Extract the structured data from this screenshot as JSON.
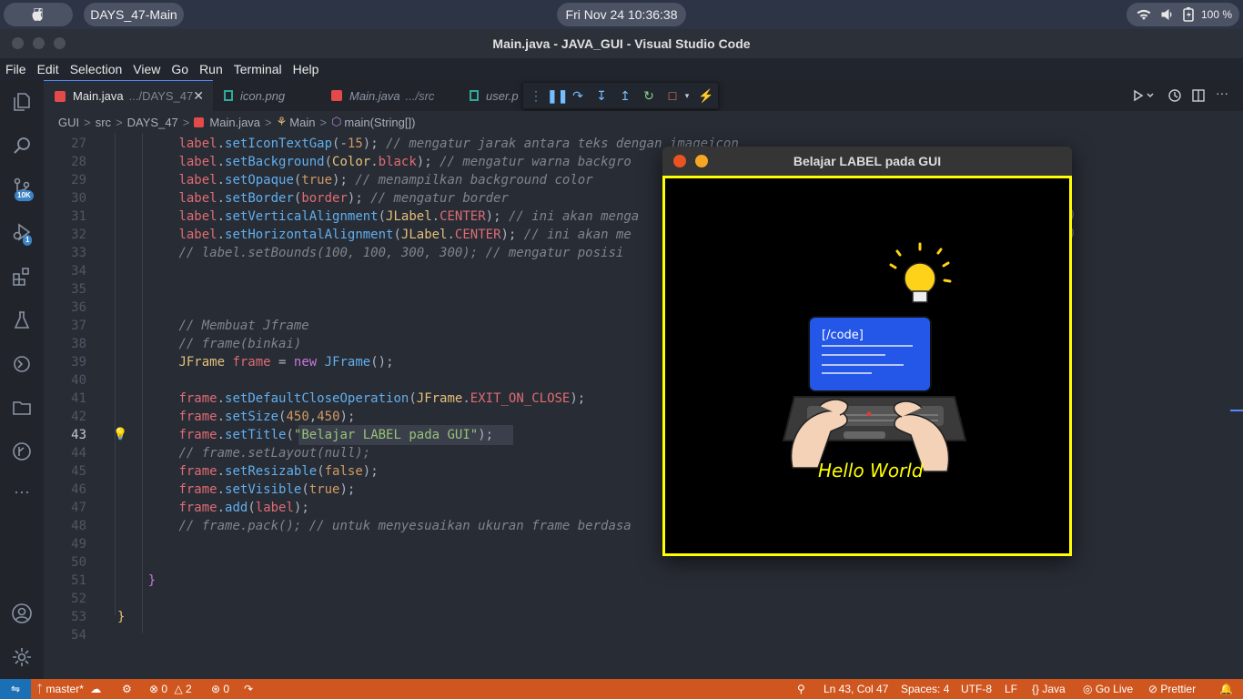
{
  "topbar": {
    "workspace": "DAYS_47-Main",
    "datetime": "Fri Nov 24  10:36:38",
    "battery": "100 %"
  },
  "window": {
    "title": "Main.java - JAVA_GUI - Visual Studio Code"
  },
  "menu": [
    "File",
    "Edit",
    "Selection",
    "View",
    "Go",
    "Run",
    "Terminal",
    "Help"
  ],
  "activity": {
    "scm_badge": "10K",
    "debug_badge": "1"
  },
  "tabs": [
    {
      "label": "Main.java",
      "path": ".../DAYS_47"
    },
    {
      "label": "icon.png",
      "path": ""
    },
    {
      "label": "Main.java",
      "path": ".../src"
    },
    {
      "label": "user.p",
      "path": ""
    }
  ],
  "breadcrumb": [
    "GUI",
    "src",
    "DAYS_47",
    "Main.java",
    "Main",
    "main(String[])"
  ],
  "editor": {
    "current_line": 43
  },
  "code_lines": [
    {
      "n": "27",
      "tokens": [
        {
          "t": "        ",
          "c": "p"
        },
        {
          "t": "label",
          "c": "v"
        },
        {
          "t": ".",
          "c": "p"
        },
        {
          "t": "setIconTextGap",
          "c": "f"
        },
        {
          "t": "(-",
          "c": "p"
        },
        {
          "t": "15",
          "c": "n"
        },
        {
          "t": "); ",
          "c": "p"
        },
        {
          "t": "// mengatur jarak antara teks dengan imageicon",
          "c": "c"
        }
      ]
    },
    {
      "n": "28",
      "tokens": [
        {
          "t": "        ",
          "c": "p"
        },
        {
          "t": "label",
          "c": "v"
        },
        {
          "t": ".",
          "c": "p"
        },
        {
          "t": "setBackground",
          "c": "f"
        },
        {
          "t": "(",
          "c": "p"
        },
        {
          "t": "Color",
          "c": "t"
        },
        {
          "t": ".",
          "c": "p"
        },
        {
          "t": "black",
          "c": "v"
        },
        {
          "t": "); ",
          "c": "p"
        },
        {
          "t": "// mengatur warna backgro",
          "c": "c"
        }
      ]
    },
    {
      "n": "29",
      "tokens": [
        {
          "t": "        ",
          "c": "p"
        },
        {
          "t": "label",
          "c": "v"
        },
        {
          "t": ".",
          "c": "p"
        },
        {
          "t": "setOpaque",
          "c": "f"
        },
        {
          "t": "(",
          "c": "p"
        },
        {
          "t": "true",
          "c": "n"
        },
        {
          "t": "); ",
          "c": "p"
        },
        {
          "t": "// menampilkan background color",
          "c": "c"
        }
      ]
    },
    {
      "n": "30",
      "tokens": [
        {
          "t": "        ",
          "c": "p"
        },
        {
          "t": "label",
          "c": "v"
        },
        {
          "t": ".",
          "c": "p"
        },
        {
          "t": "setBorder",
          "c": "f"
        },
        {
          "t": "(",
          "c": "p"
        },
        {
          "t": "border",
          "c": "v"
        },
        {
          "t": "); ",
          "c": "p"
        },
        {
          "t": "// mengatur border",
          "c": "c"
        }
      ]
    },
    {
      "n": "31",
      "tokens": [
        {
          "t": "        ",
          "c": "p"
        },
        {
          "t": "label",
          "c": "v"
        },
        {
          "t": ".",
          "c": "p"
        },
        {
          "t": "setVerticalAlignment",
          "c": "f"
        },
        {
          "t": "(",
          "c": "p"
        },
        {
          "t": "JLabel",
          "c": "t"
        },
        {
          "t": ".",
          "c": "p"
        },
        {
          "t": "CENTER",
          "c": "v"
        },
        {
          "t": "); ",
          "c": "p"
        },
        {
          "t": "// ini akan menga                                        ical(TOP, BOTTOM)",
          "c": "c"
        }
      ]
    },
    {
      "n": "32",
      "tokens": [
        {
          "t": "        ",
          "c": "p"
        },
        {
          "t": "label",
          "c": "v"
        },
        {
          "t": ".",
          "c": "p"
        },
        {
          "t": "setHorizontalAlignment",
          "c": "f"
        },
        {
          "t": "(",
          "c": "p"
        },
        {
          "t": "JLabel",
          "c": "t"
        },
        {
          "t": ".",
          "c": "p"
        },
        {
          "t": "CENTER",
          "c": "v"
        },
        {
          "t": "); ",
          "c": "p"
        },
        {
          "t": "// ini akan me                                       rtical(LEFT, RIGHT)",
          "c": "c"
        }
      ]
    },
    {
      "n": "33",
      "tokens": [
        {
          "t": "        ",
          "c": "p"
        },
        {
          "t": "// label.setBounds(100, 100, 300, 300); // mengatur posisi",
          "c": "c"
        }
      ]
    },
    {
      "n": "34",
      "tokens": []
    },
    {
      "n": "35",
      "tokens": []
    },
    {
      "n": "36",
      "tokens": []
    },
    {
      "n": "37",
      "tokens": [
        {
          "t": "        ",
          "c": "p"
        },
        {
          "t": "// Membuat Jframe",
          "c": "c"
        }
      ]
    },
    {
      "n": "38",
      "tokens": [
        {
          "t": "        ",
          "c": "p"
        },
        {
          "t": "// frame(binkai)",
          "c": "c"
        }
      ]
    },
    {
      "n": "39",
      "tokens": [
        {
          "t": "        ",
          "c": "p"
        },
        {
          "t": "JFrame",
          "c": "t"
        },
        {
          "t": " ",
          "c": "p"
        },
        {
          "t": "frame",
          "c": "v"
        },
        {
          "t": " = ",
          "c": "p"
        },
        {
          "t": "new",
          "c": "k"
        },
        {
          "t": " ",
          "c": "p"
        },
        {
          "t": "JFrame",
          "c": "f"
        },
        {
          "t": "();",
          "c": "p"
        }
      ]
    },
    {
      "n": "40",
      "tokens": []
    },
    {
      "n": "41",
      "tokens": [
        {
          "t": "        ",
          "c": "p"
        },
        {
          "t": "frame",
          "c": "v"
        },
        {
          "t": ".",
          "c": "p"
        },
        {
          "t": "setDefaultCloseOperation",
          "c": "f"
        },
        {
          "t": "(",
          "c": "p"
        },
        {
          "t": "JFrame",
          "c": "t"
        },
        {
          "t": ".",
          "c": "p"
        },
        {
          "t": "EXIT_ON_CLOSE",
          "c": "v"
        },
        {
          "t": ");",
          "c": "p"
        }
      ]
    },
    {
      "n": "42",
      "tokens": [
        {
          "t": "        ",
          "c": "p"
        },
        {
          "t": "frame",
          "c": "v"
        },
        {
          "t": ".",
          "c": "p"
        },
        {
          "t": "setSize",
          "c": "f"
        },
        {
          "t": "(",
          "c": "p"
        },
        {
          "t": "450",
          "c": "n"
        },
        {
          "t": ",",
          "c": "p"
        },
        {
          "t": "450",
          "c": "n"
        },
        {
          "t": ");",
          "c": "p"
        }
      ]
    },
    {
      "n": "43",
      "tokens": [
        {
          "t": "        ",
          "c": "p"
        },
        {
          "t": "frame",
          "c": "v"
        },
        {
          "t": ".",
          "c": "p"
        },
        {
          "t": "setTitle",
          "c": "f"
        },
        {
          "t": "(",
          "c": "p"
        },
        {
          "t": "\"Belajar LABEL pada GUI\"",
          "c": "s"
        },
        {
          "t": ");",
          "c": "p"
        }
      ]
    },
    {
      "n": "44",
      "tokens": [
        {
          "t": "        ",
          "c": "p"
        },
        {
          "t": "// frame.setLayout(null);",
          "c": "c"
        }
      ]
    },
    {
      "n": "45",
      "tokens": [
        {
          "t": "        ",
          "c": "p"
        },
        {
          "t": "frame",
          "c": "v"
        },
        {
          "t": ".",
          "c": "p"
        },
        {
          "t": "setResizable",
          "c": "f"
        },
        {
          "t": "(",
          "c": "p"
        },
        {
          "t": "false",
          "c": "n"
        },
        {
          "t": ");",
          "c": "p"
        }
      ]
    },
    {
      "n": "46",
      "tokens": [
        {
          "t": "        ",
          "c": "p"
        },
        {
          "t": "frame",
          "c": "v"
        },
        {
          "t": ".",
          "c": "p"
        },
        {
          "t": "setVisible",
          "c": "f"
        },
        {
          "t": "(",
          "c": "p"
        },
        {
          "t": "true",
          "c": "n"
        },
        {
          "t": ");",
          "c": "p"
        }
      ]
    },
    {
      "n": "47",
      "tokens": [
        {
          "t": "        ",
          "c": "p"
        },
        {
          "t": "frame",
          "c": "v"
        },
        {
          "t": ".",
          "c": "p"
        },
        {
          "t": "add",
          "c": "f"
        },
        {
          "t": "(",
          "c": "p"
        },
        {
          "t": "label",
          "c": "v"
        },
        {
          "t": ");",
          "c": "p"
        }
      ]
    },
    {
      "n": "48",
      "tokens": [
        {
          "t": "        ",
          "c": "p"
        },
        {
          "t": "// frame.pack(); // untuk menyesuaikan ukuran frame berdasa",
          "c": "c"
        }
      ]
    },
    {
      "n": "49",
      "tokens": []
    },
    {
      "n": "50",
      "tokens": []
    },
    {
      "n": "51",
      "tokens": [
        {
          "t": "    ",
          "c": "p"
        },
        {
          "t": "}",
          "c": "k"
        }
      ]
    },
    {
      "n": "52",
      "tokens": []
    },
    {
      "n": "53",
      "tokens": [
        {
          "t": "}",
          "c": "t"
        }
      ]
    },
    {
      "n": "54",
      "tokens": []
    }
  ],
  "gui_window": {
    "title": "Belajar LABEL pada GUI",
    "label_text": "Hello World",
    "code_screen_text": "[/code]"
  },
  "status": {
    "branch": "master*",
    "errors": "0",
    "warnings": "2",
    "ports": "0",
    "position": "Ln 43, Col 47",
    "spaces": "Spaces: 4",
    "encoding": "UTF-8",
    "eol": "LF",
    "language": "Java",
    "golive": "Go Live",
    "prettier": "Prettier"
  },
  "colors": {
    "statusbar": "#d0561f",
    "label_border": "#ffff00",
    "label_text": "#ffff00"
  }
}
